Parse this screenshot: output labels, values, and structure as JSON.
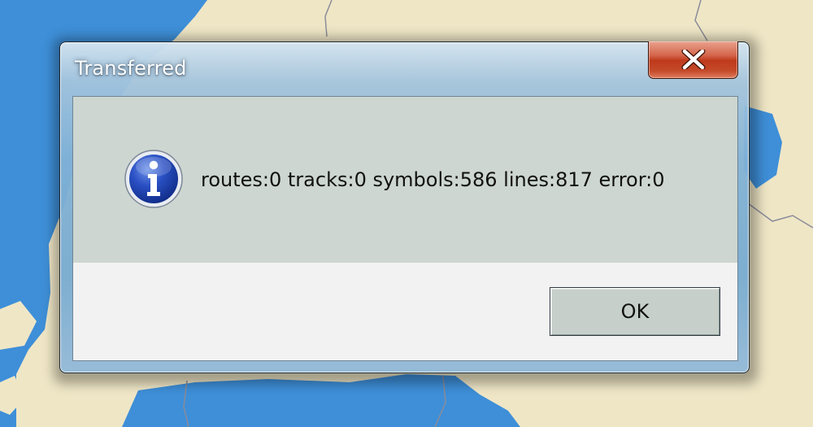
{
  "colors": {
    "sea": "#3e8fd8",
    "land": "#efe6c6",
    "border_line": "#8a8c9a",
    "content_bg": "#cdd6d0",
    "close_red": "#c8432a",
    "info_blue": "#1a3da8"
  },
  "map": {
    "layer": "background-map"
  },
  "dialog": {
    "title": "Transferred",
    "close_icon": "close-icon",
    "info_icon": "info-icon",
    "message": "routes:0 tracks:0 symbols:586 lines:817 error:0",
    "ok_label": "OK"
  }
}
